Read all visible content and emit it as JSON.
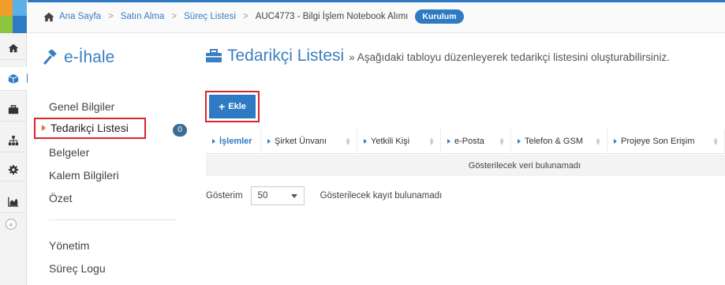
{
  "colors": {
    "accent": "#2e7bc4",
    "highlight": "#d9262c",
    "badge": "#3a6d95"
  },
  "breadcrumb": {
    "items": [
      "Ana Sayfa",
      "Satın Alma",
      "Süreç Listesi"
    ],
    "current": "AUC4773 - Bilgi İşlem Notebook Alımı",
    "status": "Kurulum"
  },
  "rail": {
    "icons": [
      "home-icon",
      "cube-icon",
      "briefcase-icon",
      "sitemap-icon",
      "gear-icon",
      "area-chart-icon"
    ],
    "collapse": "«"
  },
  "sidebar": {
    "brand": "e-İhale",
    "items": [
      {
        "label": "Genel Bilgiler"
      },
      {
        "label": "Tedarikçi Listesi",
        "count": "0"
      },
      {
        "label": "Belgeler"
      },
      {
        "label": "Kalem Bilgileri"
      },
      {
        "label": "Özet"
      },
      {
        "label": "Yönetim"
      },
      {
        "label": "Süreç Logu"
      }
    ]
  },
  "main": {
    "title": "Tedarikçi Listesi",
    "subtitle": "» Aşağıdaki tabloyu düzenleyerek tedarikçi listesini oluşturabilirsiniz.",
    "add_label": "Ekle",
    "columns": [
      "İşlemler",
      "Şirket Ünvanı",
      "Yetkili Kişi",
      "e-Posta",
      "Telefon & GSM",
      "Projeye Son Erişim"
    ],
    "empty": "Gösterilecek veri bulunamadı",
    "footer": {
      "show_label": "Gösterim",
      "page_size": "50",
      "info": "Gösterilecek kayıt bulunamadı"
    }
  }
}
